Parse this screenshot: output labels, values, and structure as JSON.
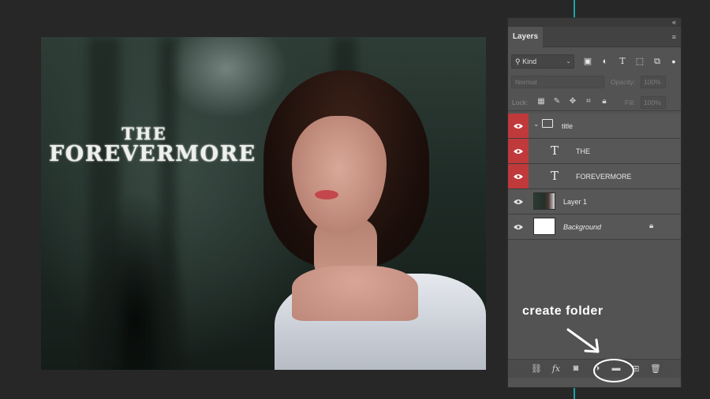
{
  "canvas": {
    "title_line1": "THE",
    "title_line2": "FOREVERMORE"
  },
  "panel": {
    "tab_label": "Layers",
    "filter": {
      "kind_label": "Kind",
      "icons": [
        "image-filter-icon",
        "adjustment-filter-icon",
        "type-filter-icon",
        "shape-filter-icon",
        "smart-object-filter-icon"
      ]
    },
    "blend_mode": "Normal",
    "opacity_label": "Opacity:",
    "opacity_value": "100%",
    "lock_label": "Lock:",
    "fill_label": "Fill:",
    "fill_value": "100%",
    "layers": [
      {
        "name": "title",
        "type": "group",
        "selected": true
      },
      {
        "name": "THE",
        "type": "text",
        "selected": true
      },
      {
        "name": "FOREVERMORE",
        "type": "text",
        "selected": true
      },
      {
        "name": "Layer 1",
        "type": "pixel",
        "selected": false
      },
      {
        "name": "Background",
        "type": "background",
        "selected": false,
        "locked": true
      }
    ],
    "bottom_icons": [
      "link-layers-icon",
      "fx-icon",
      "add-mask-icon",
      "adjustment-layer-icon",
      "create-group-icon",
      "new-layer-icon",
      "delete-layer-icon"
    ]
  },
  "annotation": {
    "text": "create folder"
  },
  "colors": {
    "selected_eye": "#c0393b",
    "guide": "#1fa3a8",
    "panel_bg": "#535353"
  }
}
